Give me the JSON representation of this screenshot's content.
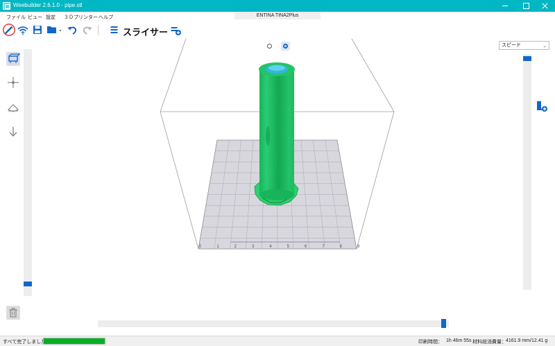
{
  "window": {
    "title": "Weebuilder 2.6.1.0 - pipe.stl"
  },
  "menu": {
    "items": [
      "ファイル",
      "ビュー",
      "設定",
      "３Ｄプリンター",
      "ヘルプ"
    ]
  },
  "printer": {
    "name": "ENTINA TINA2Plus"
  },
  "toolbar": {
    "icons": [
      "brush-icon",
      "wifi-icon",
      "save-icon",
      "folder-open-icon",
      "undo-icon",
      "redo-icon",
      "slicer-icon",
      "print-send-icon"
    ],
    "slicer_label": "スライサー"
  },
  "view": {
    "mode_label": "スピード",
    "radio_selected_index": 1,
    "left_tools": [
      "view-3d-icon",
      "move-icon",
      "layer-icon",
      "arrow-down-icon"
    ],
    "build_plate_ticks": [
      "0",
      "1",
      "2",
      "3",
      "4",
      "5",
      "6",
      "7",
      "8",
      "9"
    ],
    "layer_slider_left_position": 0.05,
    "layer_slider_right_position": 0.99,
    "horizontal_slider_position": 0.99
  },
  "colors": {
    "accent": "#1266c8",
    "titlebar": "#00b7c3",
    "model": "#22c86a",
    "highlight": "#e0301f"
  },
  "status": {
    "message": "すべて完了しました。",
    "progress": 1.0,
    "print_time_label": "印刷時間：",
    "print_time_value": "1h 46m 55s",
    "material_label": "材料総消費量：",
    "material_value": "4161.9 mm/12.41 g"
  }
}
